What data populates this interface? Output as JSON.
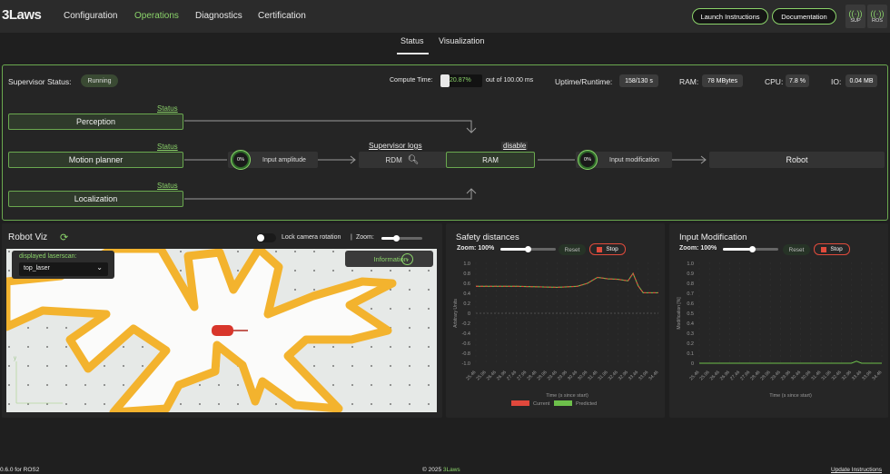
{
  "header": {
    "brand": "3Laws",
    "nav": [
      "Configuration",
      "Operations",
      "Diagnostics",
      "Certification"
    ],
    "active_nav": "Operations",
    "launch_label": "Launch Instructions",
    "docs_label": "Documentation",
    "tools": [
      {
        "label": "SUP",
        "icon": "signal-icon"
      },
      {
        "label": "ROS",
        "icon": "signal-icon"
      }
    ]
  },
  "tabs": {
    "items": [
      "Status",
      "Visualization"
    ],
    "active": "Status"
  },
  "supervisor": {
    "status_label": "Supervisor Status:",
    "status_value": "Running",
    "compute_label": "Compute Time:",
    "compute_value": "20.87%",
    "compute_fraction": 0.2087,
    "compute_suffix": "out of 100.00 ms",
    "uptime_label": "Uptime/Runtime:",
    "uptime_value": "158/130 s",
    "ram_label": "RAM:",
    "ram_value": "78 MBytes",
    "cpu_label": "CPU:",
    "cpu_value": "7.8 %",
    "io_label": "IO:",
    "io_value": "0.04 MB"
  },
  "pipeline": {
    "status_link": "Status",
    "perception": "Perception",
    "motion_planner": "Motion planner",
    "localization": "Localization",
    "input_amplitude_pct": "0%",
    "input_amplitude": "Input amplitude",
    "supervisor_logs": "Supervisor logs",
    "disable": "disable",
    "rdm": "RDM",
    "ram": "RAM",
    "input_modification_pct": "0%",
    "input_modification": "Input modification",
    "robot": "Robot"
  },
  "robot_viz": {
    "title": "Robot Viz",
    "lock_label": "Lock camera rotation",
    "sep": "|",
    "zoom_label": "Zoom:",
    "zoom_fraction": 0.35,
    "scan_label": "displayed laserscan:",
    "scan_value": "top_laser",
    "info_label": "Information"
  },
  "safety": {
    "title": "Safety distances",
    "zoom_label": "Zoom: 100%",
    "reset": "Reset",
    "stop": "Stop",
    "legend_current": "Current",
    "legend_predicted": "Predicted"
  },
  "input_mod": {
    "title": "Input Modification",
    "zoom_label": "Zoom: 100%",
    "reset": "Reset",
    "stop": "Stop"
  },
  "chart_data": [
    {
      "type": "line",
      "xlabel": "Time (s since start)",
      "ylabel": "Arbitrary Units",
      "ylim": [
        -1.0,
        1.0
      ],
      "y_ticks": [
        "1.0",
        "0.8",
        "0.6",
        "0.4",
        "0.2",
        "0",
        "-0.2",
        "-0.4",
        "-0.6",
        "-0.8",
        "-1.0"
      ],
      "x_ticks": [
        "25.46",
        "25.96",
        "26.46",
        "26.96",
        "27.46",
        "27.96",
        "28.46",
        "28.96",
        "29.46",
        "29.96",
        "30.46",
        "30.96",
        "31.46",
        "31.96",
        "32.46",
        "32.96",
        "33.46",
        "33.96",
        "34.46"
      ],
      "x": [
        25.46,
        26.46,
        27.46,
        28.46,
        29.46,
        30.46,
        30.96,
        31.46,
        31.96,
        32.46,
        32.96,
        33.21,
        33.46,
        33.71,
        33.96,
        34.46
      ],
      "series": [
        {
          "name": "Current",
          "color": "#e0483c",
          "values": [
            0.54,
            0.54,
            0.54,
            0.53,
            0.52,
            0.54,
            0.6,
            0.72,
            0.69,
            0.68,
            0.65,
            0.8,
            0.55,
            0.41,
            0.41,
            0.41
          ]
        },
        {
          "name": "Predicted",
          "color": "#6dc04b",
          "values": [
            0.54,
            0.54,
            0.54,
            0.53,
            0.52,
            0.54,
            0.6,
            0.72,
            0.69,
            0.68,
            0.65,
            0.8,
            0.55,
            0.41,
            0.41,
            0.41
          ]
        }
      ],
      "reference_line": 0.0
    },
    {
      "type": "line",
      "xlabel": "Time (s since start)",
      "ylabel": "Modification [%]",
      "ylim": [
        0,
        1.0
      ],
      "y_ticks": [
        "1.0",
        "0.9",
        "0.8",
        "0.7",
        "0.6",
        "0.5",
        "0.4",
        "0.3",
        "0.2",
        "0.1",
        "0"
      ],
      "x_ticks": [
        "25.46",
        "25.96",
        "26.46",
        "26.96",
        "27.46",
        "27.96",
        "28.46",
        "28.96",
        "29.46",
        "29.96",
        "30.46",
        "30.96",
        "31.46",
        "31.96",
        "32.46",
        "32.96",
        "33.46",
        "33.96",
        "34.46"
      ],
      "x": [
        25.46,
        27.46,
        29.46,
        31.46,
        32.96,
        33.21,
        33.46,
        34.46
      ],
      "series": [
        {
          "color": "#6dc04b",
          "values": [
            0,
            0,
            0,
            0,
            0,
            0.02,
            0,
            0
          ]
        }
      ]
    }
  ],
  "footer": {
    "version": "0.6.0 for ROS2",
    "copyright": "© 2025",
    "copyright_link": "3Laws",
    "update": "Update Instructions"
  },
  "colors": {
    "accent": "#8bd36a",
    "stop": "#e04b3c",
    "laser": "#f3b32e",
    "robot": "#d8362b"
  }
}
